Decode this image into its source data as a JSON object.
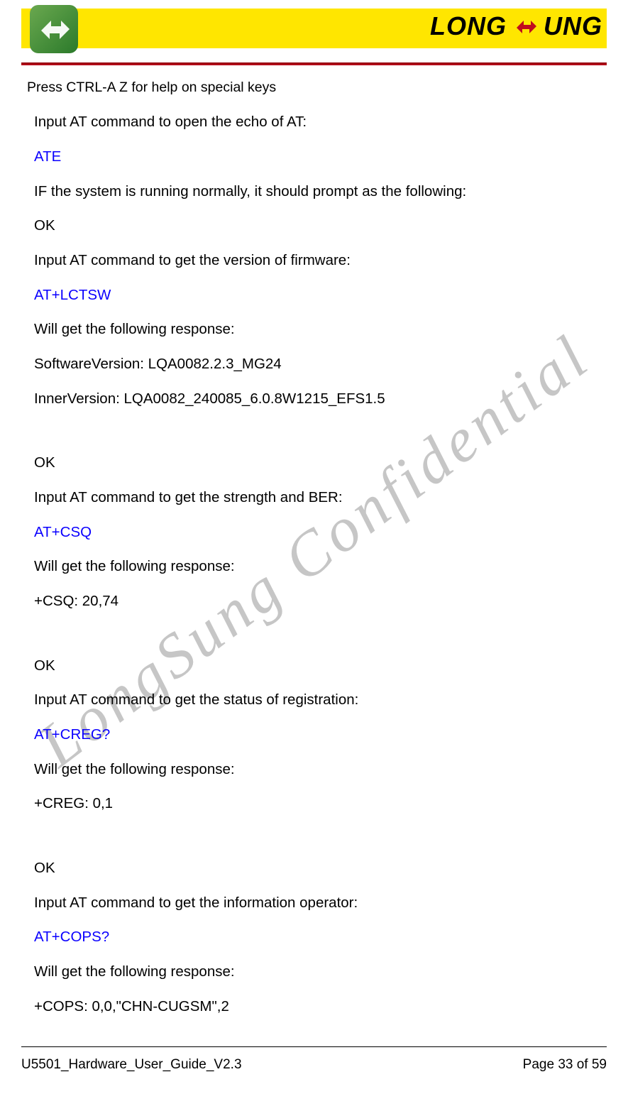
{
  "brand": {
    "text_left": "LONG",
    "text_right": "UNG"
  },
  "watermark": "LongSung Confidential",
  "body": {
    "first_line": "Press CTRL-A Z for help on special keys",
    "p1": "Input AT command to open the echo of AT:",
    "cmd1": "ATE",
    "p2": "IF the system is running normally, it should prompt as the following:",
    "ok1": "OK",
    "p3": "Input AT command to get the version of firmware:",
    "cmd2": "AT+LCTSW",
    "p4": "Will get the following response:",
    "r1": "SoftwareVersion: LQA0082.2.3_MG24",
    "r2": "InnerVersion: LQA0082_240085_6.0.8W1215_EFS1.5",
    "ok2": "OK",
    "p5": "Input AT command to get the strength and BER:",
    "cmd3": "AT+CSQ",
    "p6": "Will get the following response:",
    "r3": "+CSQ: 20,74",
    "ok3": "OK",
    "p7": "Input AT command to get the status of registration:",
    "cmd4": "AT+CREG?",
    "p8": "Will get the following response:",
    "r4": "+CREG: 0,1",
    "ok4": "OK",
    "p9": "Input AT command to get the information operator:",
    "cmd5": "AT+COPS?",
    "p10": "Will get the following response:",
    "r5": "+COPS: 0,0,\"CHN-CUGSM\",2"
  },
  "footer": {
    "doc": "U5501_Hardware_User_Guide_V2.3",
    "page": "Page 33 of 59"
  }
}
